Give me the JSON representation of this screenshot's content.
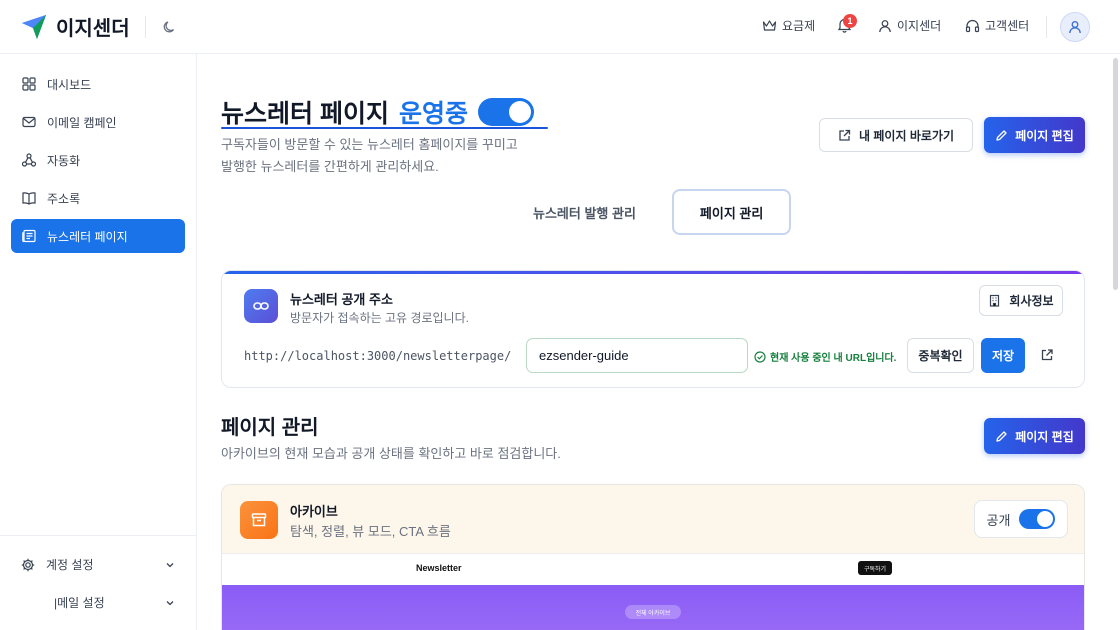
{
  "header": {
    "app_name": "이지센더",
    "nav": {
      "pricing": "요금제",
      "notifications_count": "1",
      "account": "이지센더",
      "support": "고객센터"
    }
  },
  "sidebar": {
    "items": [
      {
        "label": "대시보드"
      },
      {
        "label": "이메일 캠페인"
      },
      {
        "label": "자동화"
      },
      {
        "label": "주소록"
      },
      {
        "label": "뉴스레터 페이지"
      }
    ],
    "bottom": [
      {
        "label": "계정 설정"
      },
      {
        "label": "|메일 설정"
      }
    ]
  },
  "page": {
    "title": "뉴스레터 페이지",
    "status": "운영중",
    "description_line1": "구독자들이 방문할 수 있는 뉴스레터 홈페이지를 꾸미고",
    "description_line2": "발행한 뉴스레터를 간편하게 관리하세요.",
    "goto_button": "내 페이지 바로가기",
    "edit_button": "페이지 편집"
  },
  "tabs": [
    {
      "label": "뉴스레터 발행 관리"
    },
    {
      "label": "페이지 관리"
    }
  ],
  "public_url": {
    "title": "뉴스레터 공개 주소",
    "subtitle": "방문자가 접속하는 고유 경로입니다.",
    "company_button": "회사정보",
    "base_url": "http://localhost:3000/newsletterpage/",
    "slug_value": "ezsender-guide",
    "status_message": "현재 사용 중인 내 URL입니다.",
    "check_button": "중복확인",
    "save_button": "저장"
  },
  "page_management": {
    "title": "페이지 관리",
    "description": "아카이브의 현재 모습과 공개 상태를 확인하고 바로 점검합니다.",
    "edit_button": "페이지 편집"
  },
  "archive": {
    "title": "아카이브",
    "subtitle": "탐색, 정렬, 뷰 모드, CTA 흐름",
    "public_label": "공개",
    "public_on": true,
    "preview_brand": "Newsletter",
    "preview_subscribe": "구독하기",
    "preview_pill": "전체 아카이브"
  },
  "colors": {
    "accent": "#1a73e8",
    "success": "#15803d",
    "badge": "#ef4444",
    "preview_hero": "#8b5cf6"
  }
}
